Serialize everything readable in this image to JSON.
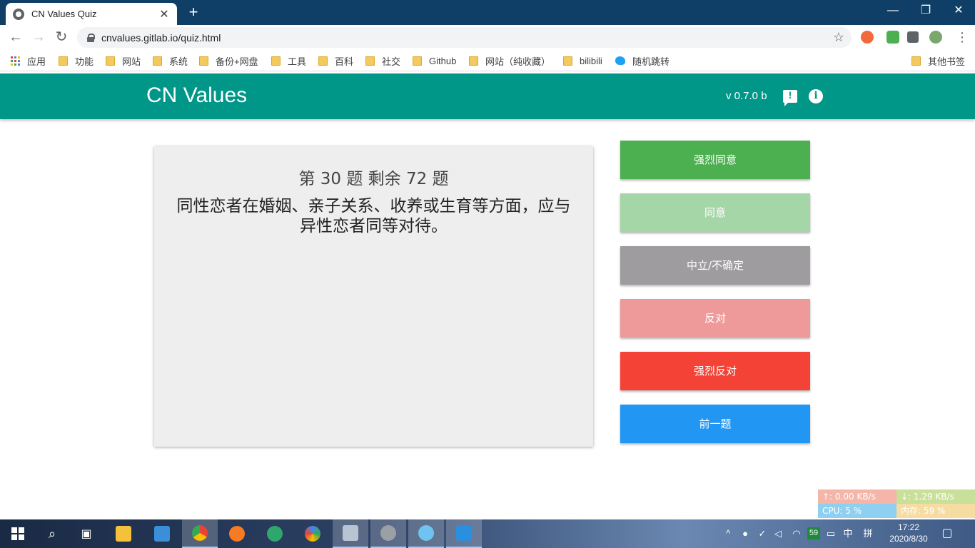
{
  "browser": {
    "tab_title": "CN Values Quiz",
    "tab_close": "✕",
    "new_tab": "+",
    "window_controls": {
      "minimize": "—",
      "restore": "❐",
      "close": "✕"
    },
    "url": "cnvalues.gitlab.io/quiz.html",
    "bookmarks": {
      "apps": "应用",
      "items": [
        "功能",
        "网站",
        "系统",
        "备份+网盘",
        "工具",
        "百科",
        "社交",
        "Github",
        "网站（纯收藏）",
        "bilibili"
      ],
      "twitter_item": "随机跳转",
      "other": "其他书签"
    }
  },
  "app": {
    "title": "CN Values",
    "version": "v 0.7.0 b"
  },
  "question": {
    "counter": "第 30 题 剩余 72 题",
    "text": "同性恋者在婚姻、亲子关系、收养或生育等方面，应与异性恋者同等对待。"
  },
  "answers": {
    "strongly_agree": "强烈同意",
    "agree": "同意",
    "neutral": "中立/不确定",
    "disagree": "反对",
    "strongly_disagree": "强烈反对",
    "previous": "前一题"
  },
  "colors": {
    "header": "#009688",
    "strongly_agree": "#4caf50",
    "agree": "#a5d6a7",
    "neutral": "#9e9c9f",
    "disagree": "#ef9a9a",
    "strongly_disagree": "#f44336",
    "previous": "#2196f3"
  },
  "net_widget": {
    "upload": "↑: 0.00 KB/s",
    "download": "↓: 1.29 KB/s",
    "cpu": "CPU: 5 %",
    "memory": "内存: 59 %"
  },
  "taskbar": {
    "tray_badge": "59",
    "input_method": "中",
    "input_mode": "拼",
    "time": "17:22",
    "date": "2020/8/30"
  }
}
